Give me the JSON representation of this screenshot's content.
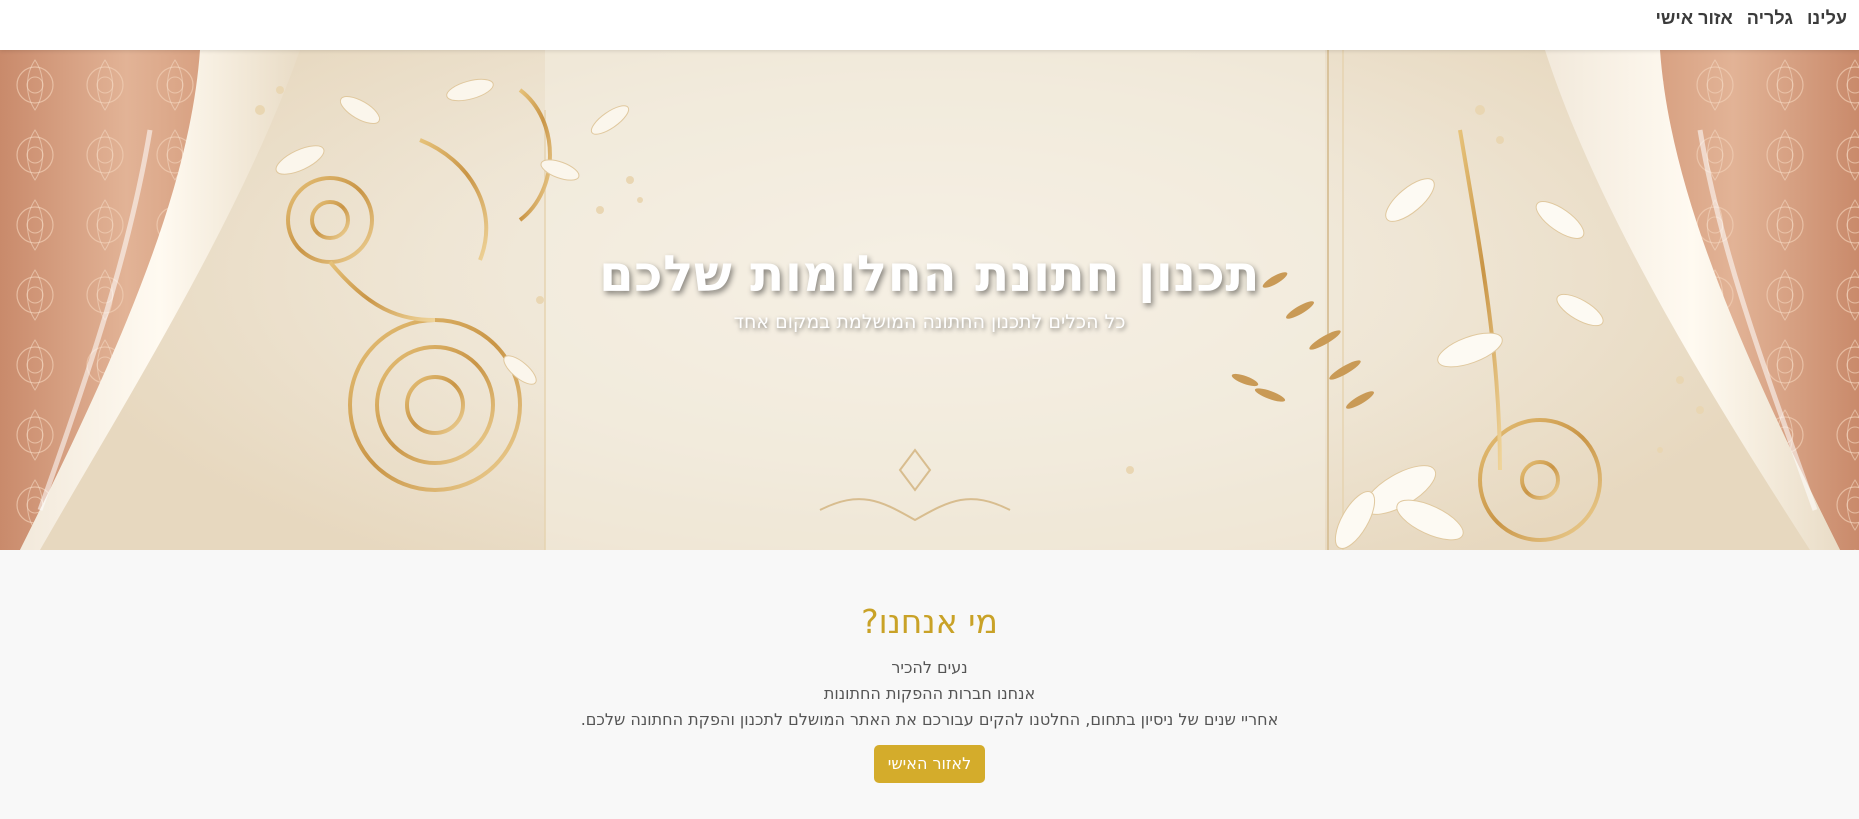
{
  "nav": {
    "items": [
      {
        "label": "עלינו"
      },
      {
        "label": "גלריה"
      },
      {
        "label": "אזור אישי"
      }
    ]
  },
  "hero": {
    "title": "תכנון חתונת החלומות שלכם",
    "subtitle": "כל הכלים לתכנון החתונה המושלמת במקום אחד"
  },
  "about": {
    "title": "מי אנחנו?",
    "lines": [
      "נעים להכיר",
      "אנחנו חברות ההפקות החתונות",
      "אחריי שנים של ניסיון בתחום, החלטנו להקים עבורכם את האתר המושלם לתכנון והפקת החתונה שלכם."
    ],
    "button_label": "לאזור האישי"
  },
  "colors": {
    "accent": "#d4ac2b",
    "heading": "#c9a227",
    "curtain": "#d9a385",
    "background": "#f8f8f8"
  }
}
